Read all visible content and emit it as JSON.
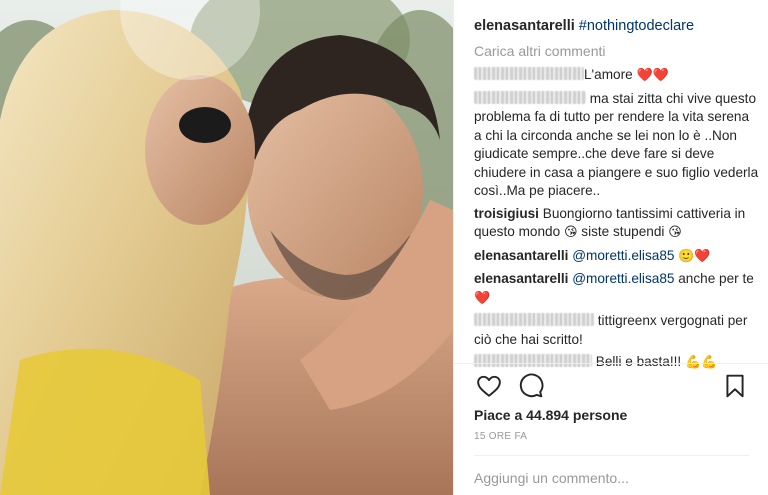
{
  "post": {
    "username": "elenasantarelli",
    "hashtag": "#nothingtodeclare",
    "load_more": "Carica altri commenti"
  },
  "comments": [
    {
      "user_blurred": true,
      "text": "L'amore",
      "suffix": "❤️❤️"
    },
    {
      "user_blurred": true,
      "text": "ma stai zitta chi vive questo problema fa di tutto per rendere la vita serena a chi la circonda anche se lei non lo è ..Non giudicate sempre..che deve fare si deve chiudere in casa a piangere e suo figlio vederla così..Ma pe piacere.."
    },
    {
      "user": "troisigiusi",
      "text": "Buongiorno tantissimi cattiveria in questo mondo",
      "mid_emoji": "😘",
      "text2": "siste stupendi",
      "end_emoji": "😘"
    },
    {
      "user": "elenasantarelli",
      "mention": "@moretti.elisa85",
      "suffix": "🙂❤️"
    },
    {
      "user": "elenasantarelli",
      "mention": "@moretti.elisa85",
      "text": "anche per te",
      "suffix": "❤️"
    },
    {
      "user_blurred": true,
      "text": "tittigreenx vergognati per ciò che hai scritto!"
    },
    {
      "user_blurred": true,
      "text": "Belli e basta!!!",
      "suffix": "💪💪"
    }
  ],
  "actions": {
    "like_icon": "heart-outline-icon",
    "comment_icon": "comment-bubble-icon",
    "save_icon": "bookmark-icon"
  },
  "likes_text": "Piace a 44.894 persone",
  "time_text": "15 ORE FA",
  "add_comment": {
    "placeholder": "Aggiungi un commento..."
  },
  "colors": {
    "text": "#262626",
    "link": "#003569",
    "muted": "#999999",
    "heart": "#e0162b"
  }
}
